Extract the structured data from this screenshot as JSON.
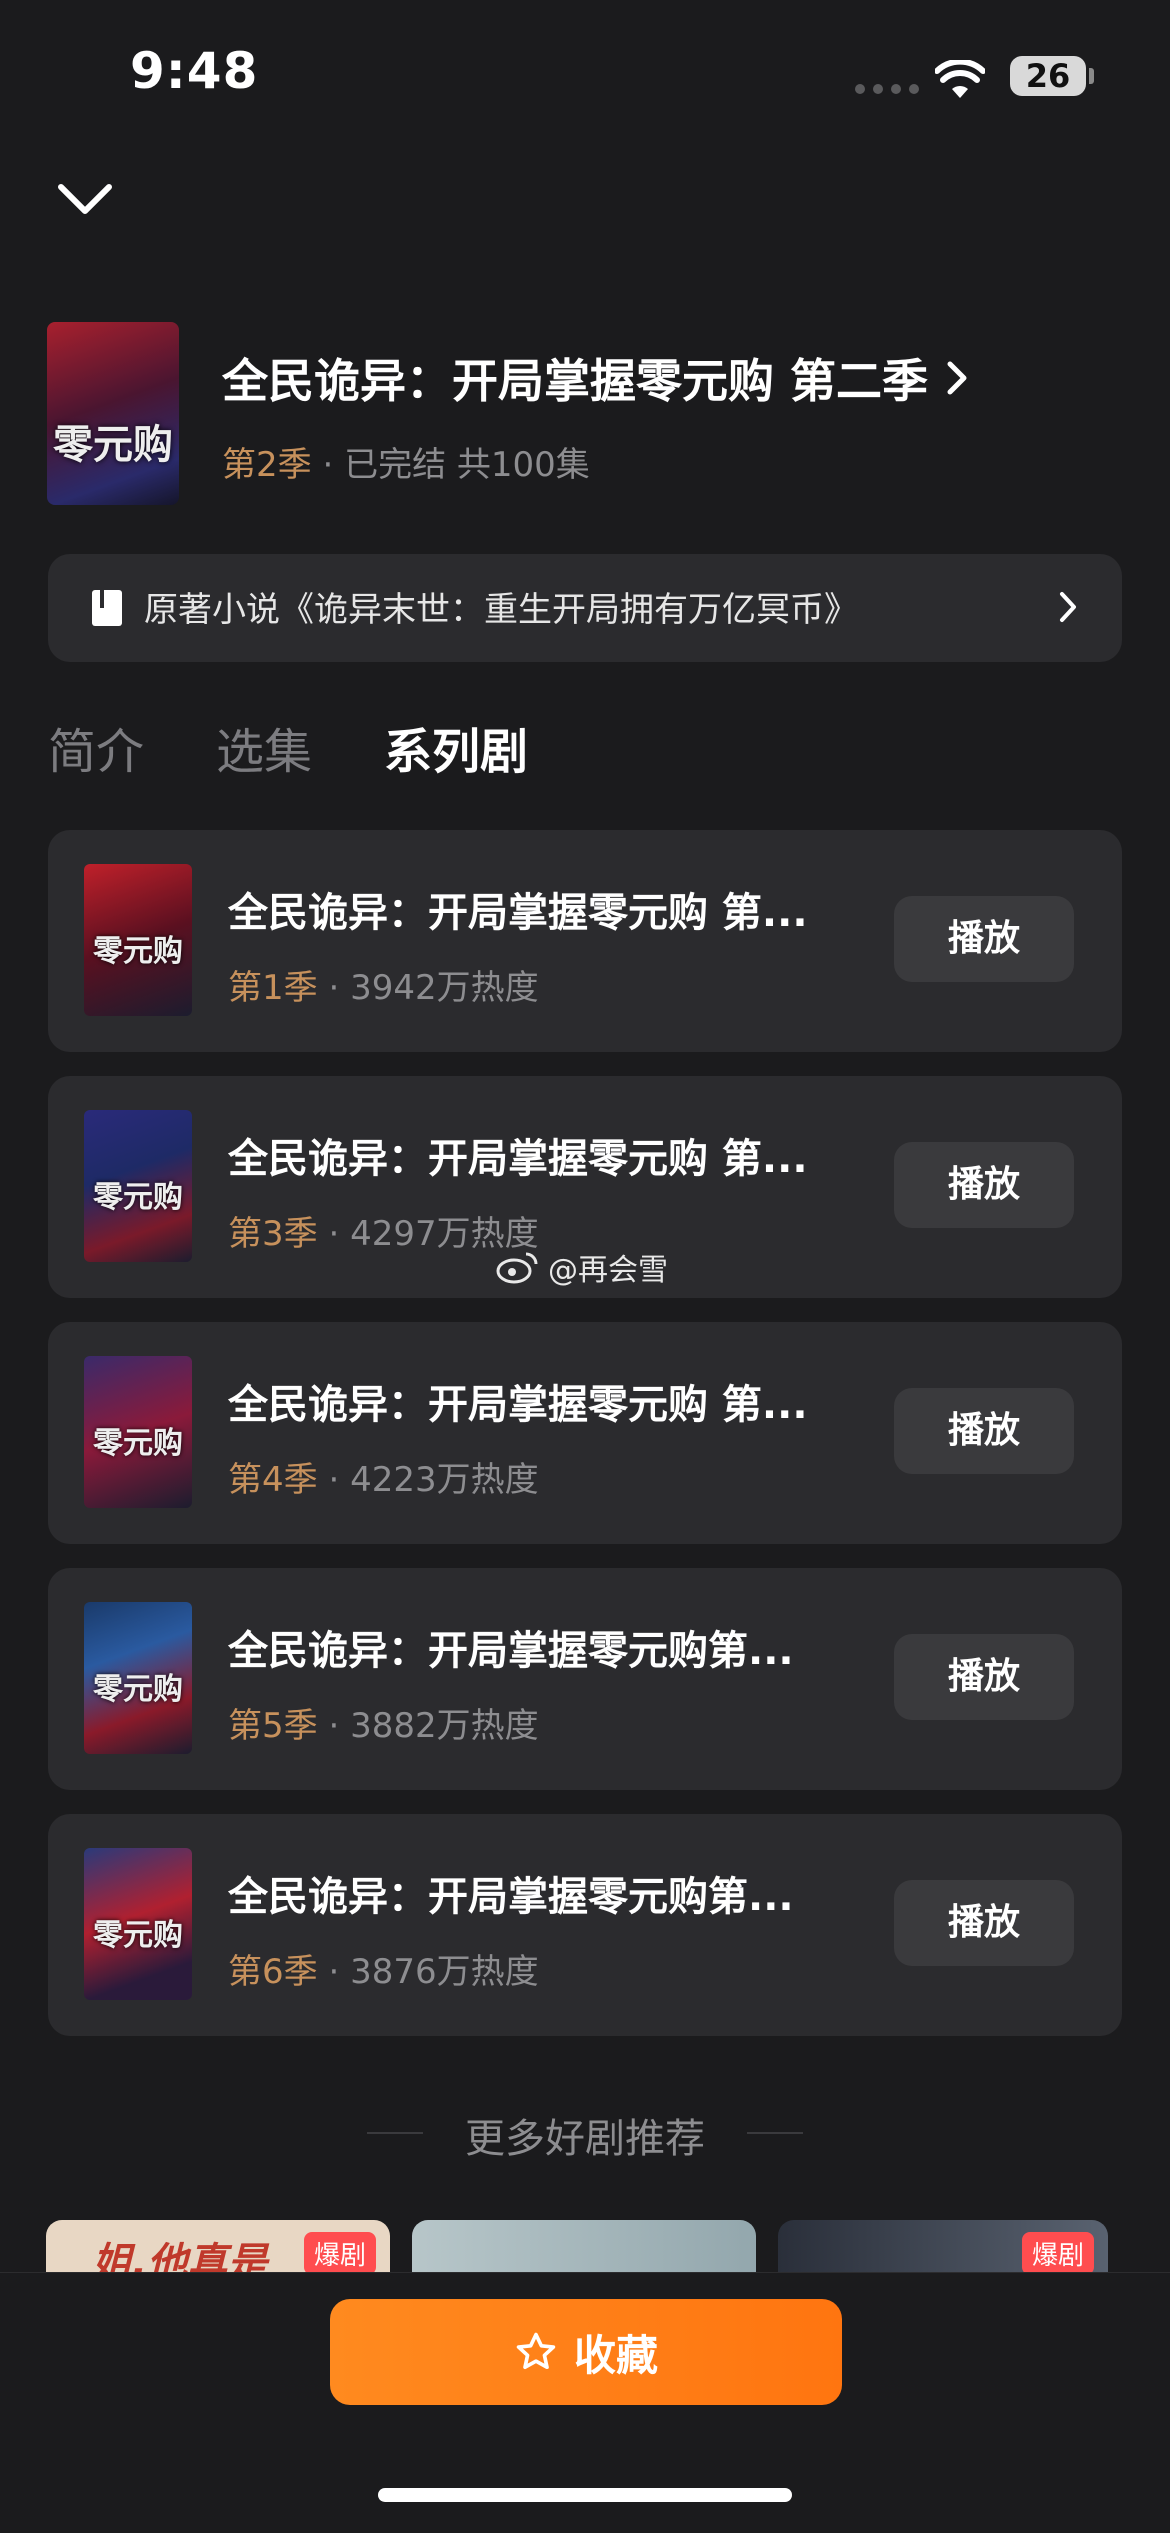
{
  "status_bar": {
    "time": "9:48",
    "battery": "26"
  },
  "header": {
    "title": "全民诡异：开局掌握零元购 第二季",
    "season": "第2季",
    "meta_rest": "· 已完结 共100集",
    "poster_glyph": "零元购"
  },
  "novel": {
    "text": "原著小说《诡异末世：重生开局拥有万亿冥币》"
  },
  "tabs": [
    {
      "label": "简介"
    },
    {
      "label": "选集"
    },
    {
      "label": "系列剧"
    }
  ],
  "series": [
    {
      "title": "全民诡异：开局掌握零元购  第...",
      "season": "第1季",
      "heat": "· 3942万热度",
      "play": "播放",
      "thumb_glyph": "零元购"
    },
    {
      "title": "全民诡异：开局掌握零元购 第...",
      "season": "第3季",
      "heat": "· 4297万热度",
      "play": "播放",
      "thumb_glyph": "零元购"
    },
    {
      "title": "全民诡异：开局掌握零元购 第...",
      "season": "第4季",
      "heat": "· 4223万热度",
      "play": "播放",
      "thumb_glyph": "零元购"
    },
    {
      "title": "全民诡异：开局掌握零元购第...",
      "season": "第5季",
      "heat": "· 3882万热度",
      "play": "播放",
      "thumb_glyph": "零元购"
    },
    {
      "title": "全民诡异：开局掌握零元购第...",
      "season": "第6季",
      "heat": "· 3876万热度",
      "play": "播放",
      "thumb_glyph": "零元购"
    }
  ],
  "watermark": "@再会雪",
  "more": {
    "title": "更多好剧推荐",
    "cards": [
      {
        "badge": "爆剧",
        "text": "姐,他真是"
      },
      {
        "badge": ""
      },
      {
        "badge": "爆剧"
      }
    ]
  },
  "favorite_button": "收藏",
  "colors": {
    "accent": "#ff7f16",
    "season_gold": "#c7915c",
    "card_bg": "#2b2b2e",
    "bg": "#1b1b1d"
  }
}
